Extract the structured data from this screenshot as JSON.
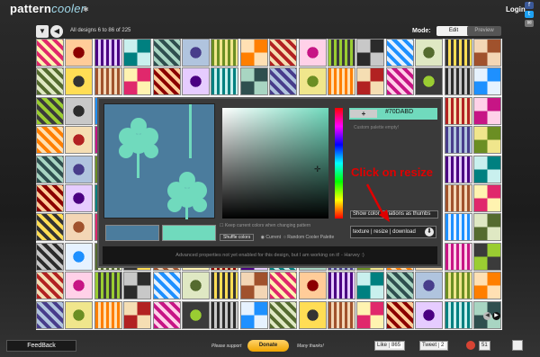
{
  "header": {
    "logo_text": "pattern",
    "logo_sub": "cooler",
    "logo_mark": "✱",
    "login_label": "Login"
  },
  "nav": {
    "menu_icon": "▼",
    "prev_icon": "◀",
    "next_icon": "▶",
    "designs_text": "All designs 6 to 86 of 225",
    "mode_label": "Mode:",
    "edit_label": "Edit",
    "preview_label": "Preview"
  },
  "editor": {
    "plus_label": "+",
    "hex_value": "#70DABD",
    "palette_note": "Custom palette empty!",
    "thumbs_label": "Show color variations as thumbs",
    "keep_label": "Keep current colors when changing pattern",
    "shuffle_label": "Shuffle colors",
    "current_label": "Current",
    "random_label": "Random Cooler Palette",
    "download_links": "texture | resize | download",
    "download_icon": "⬇",
    "advanced_note": "Advanced properties not yet enabled for this design, but I am working on it! - Harvey :)",
    "color_1": "#4b7c9d",
    "color_2": "#70dabd"
  },
  "annotation": {
    "text": "Click on resize"
  },
  "grid_nav": {
    "prev_icon": "◀",
    "next_icon": "▶"
  },
  "footer": {
    "feedback_label": "FeedBack",
    "support_text": "Please support",
    "donate_label": "Donate",
    "thanks_text": "Many thanks!",
    "like_label": "Like",
    "like_count": "865",
    "tweet_label": "Tweet",
    "tweet_count": "2",
    "plus_count": "51"
  }
}
